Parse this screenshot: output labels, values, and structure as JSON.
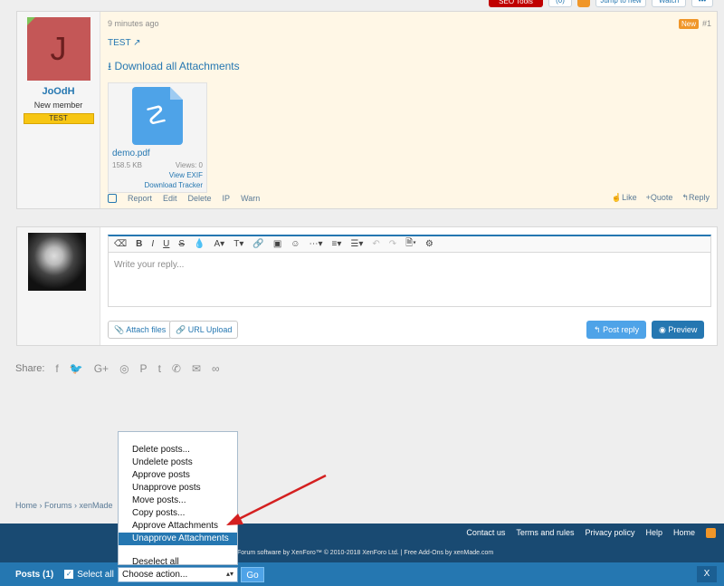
{
  "topbar": {
    "seo_tools": "SEO Tools",
    "count": "(0)",
    "jump": "Jump to new",
    "watch": "Watch",
    "more": "•••"
  },
  "post": {
    "avatar_letter": "J",
    "username": "JoOdH",
    "user_title": "New member",
    "user_banner": "TEST",
    "time": "9 minutes ago",
    "badge": "New",
    "number": "#1",
    "message": "TEST",
    "download_all": "Download all Attachments",
    "attachment": {
      "filename": "demo.pdf",
      "size": "158.5 KB",
      "views": "Views: 0",
      "view_exif": "View EXIF",
      "download_tracker": "Download Tracker"
    },
    "actions": [
      "Report",
      "Edit",
      "Delete",
      "IP",
      "Warn"
    ],
    "reactions": [
      "Like",
      "+Quote",
      "Reply"
    ]
  },
  "reply": {
    "placeholder": "Write your reply...",
    "attach_files": "Attach files",
    "url_upload": "URL Upload",
    "post_reply": "Post reply",
    "preview": "Preview"
  },
  "share": {
    "label": "Share:"
  },
  "breadcrumb": [
    "Home",
    "Forums",
    "xenMade"
  ],
  "footer": {
    "links": [
      "Contact us",
      "Terms and rules",
      "Privacy policy",
      "Help",
      "Home"
    ],
    "copyright": "Forum software by XenForo™ © 2010-2018 XenForo Ltd. | Free Add-Ons by xenMade.com"
  },
  "modbar": {
    "posts": "Posts (1)",
    "select_all": "Select all",
    "select_value": "Choose action...",
    "go": "Go",
    "close": "X"
  },
  "dropdown": {
    "items": [
      "Delete posts...",
      "Undelete posts",
      "Approve posts",
      "Unapprove posts",
      "Move posts...",
      "Copy posts...",
      "Approve Attachments",
      "Unapprove Attachments"
    ],
    "selected_index": 7,
    "deselect": "Deselect all"
  },
  "colors": {
    "accent": "#2577b1",
    "footer": "#194a72",
    "arrow": "#d42020",
    "post_bg": "#fff7e6"
  }
}
